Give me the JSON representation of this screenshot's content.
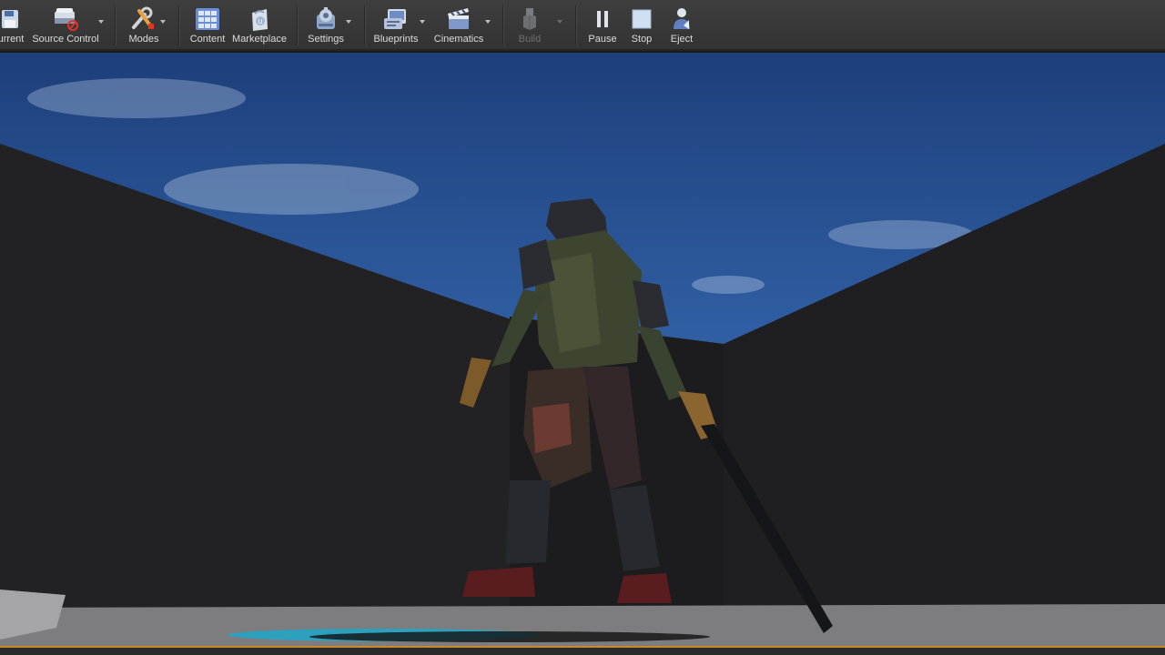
{
  "toolbar": {
    "buttons": [
      {
        "id": "save_current",
        "label": "urrent",
        "icon": "save-icon"
      },
      {
        "id": "source_control",
        "label": "Source Control",
        "icon": "source-control-icon"
      },
      {
        "id": "modes",
        "label": "Modes",
        "icon": "modes-icon"
      },
      {
        "id": "content",
        "label": "Content",
        "icon": "content-icon"
      },
      {
        "id": "marketplace",
        "label": "Marketplace",
        "icon": "marketplace-icon"
      },
      {
        "id": "settings",
        "label": "Settings",
        "icon": "settings-icon"
      },
      {
        "id": "blueprints",
        "label": "Blueprints",
        "icon": "blueprints-icon"
      },
      {
        "id": "cinematics",
        "label": "Cinematics",
        "icon": "cinematics-icon"
      },
      {
        "id": "build",
        "label": "Build",
        "icon": "build-icon",
        "disabled": true
      },
      {
        "id": "pause",
        "label": "Pause",
        "icon": "pause-icon"
      },
      {
        "id": "stop",
        "label": "Stop",
        "icon": "stop-icon"
      },
      {
        "id": "eject",
        "label": "Eject",
        "icon": "eject-icon"
      }
    ]
  },
  "colors": {
    "accent": "#c8892d",
    "toolbar_bg": "#383838",
    "sky_top": "#1d3f7a",
    "wall": "#222224",
    "floor": "#7d7d7f",
    "decal": "#1fa6c9"
  }
}
